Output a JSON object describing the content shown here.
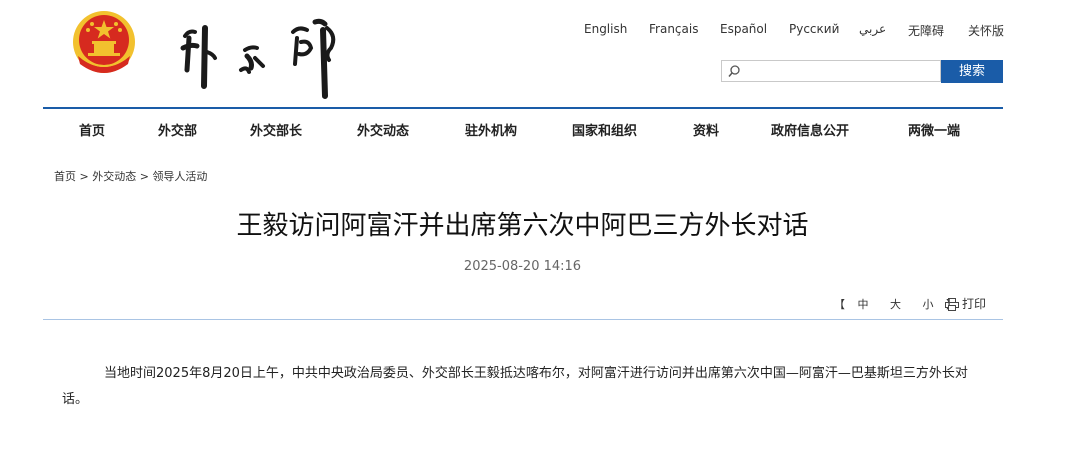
{
  "header": {
    "languages": [
      "English",
      "Français",
      "Español",
      "Русский",
      "عربي",
      "无障碍",
      "关怀版"
    ],
    "search": {
      "placeholder": "",
      "button_label": "搜索"
    }
  },
  "nav": {
    "items": [
      "首页",
      "外交部",
      "外交部长",
      "外交动态",
      "驻外机构",
      "国家和组织",
      "资料",
      "政府信息公开",
      "两微一端"
    ]
  },
  "breadcrumb": {
    "items": [
      "首页",
      "外交动态",
      "领导人活动"
    ],
    "separator": ">"
  },
  "article": {
    "title": "王毅访问阿富汗并出席第六次中阿巴三方外长对话",
    "date": "2025-08-20 14:16",
    "font_size_controls": {
      "open": "【",
      "large": "中",
      "medium": "大",
      "small": "小",
      "close": "】"
    },
    "print_label": "打印",
    "paragraph": "当地时间2025年8月20日上午，中共中央政治局委员、外交部长王毅抵达喀布尔，对阿富汗进行访问并出席第六次中国—阿富汗—巴基斯坦三方外长对话。"
  },
  "colors": {
    "accent_blue": "#1a5ca8",
    "divider_light": "#a9c4e4"
  }
}
